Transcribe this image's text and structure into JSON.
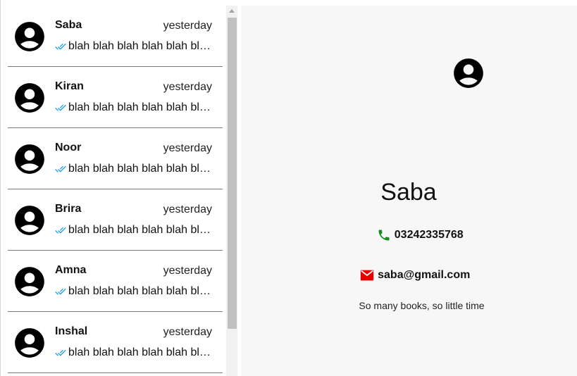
{
  "chats": [
    {
      "name": "Saba",
      "time": "yesterday",
      "preview": "blah blah blah blah blah blah blah"
    },
    {
      "name": "Kiran",
      "time": "yesterday",
      "preview": "blah blah blah blah blah blah blah"
    },
    {
      "name": "Noor",
      "time": "yesterday",
      "preview": "blah blah blah blah blah blah blah"
    },
    {
      "name": "Brira",
      "time": "yesterday",
      "preview": "blah blah blah blah blah blah blah"
    },
    {
      "name": "Amna",
      "time": "yesterday",
      "preview": "blah blah blah blah blah blah blah"
    },
    {
      "name": "Inshal",
      "time": "yesterday",
      "preview": "blah blah blah blah blah blah blah"
    }
  ],
  "detail": {
    "name": "Saba",
    "phone": "03242335768",
    "email": "saba@gmail.com",
    "status": "So many books, so little time"
  },
  "icons": {
    "avatar": "account-circle-icon",
    "read_receipt": "double-check-icon",
    "phone": "phone-icon",
    "email": "mail-icon"
  },
  "colors": {
    "tick": "#1e9be9",
    "phone": "#1a8a1a",
    "email": "#e60000",
    "panel_bg": "#f7f7f7"
  }
}
